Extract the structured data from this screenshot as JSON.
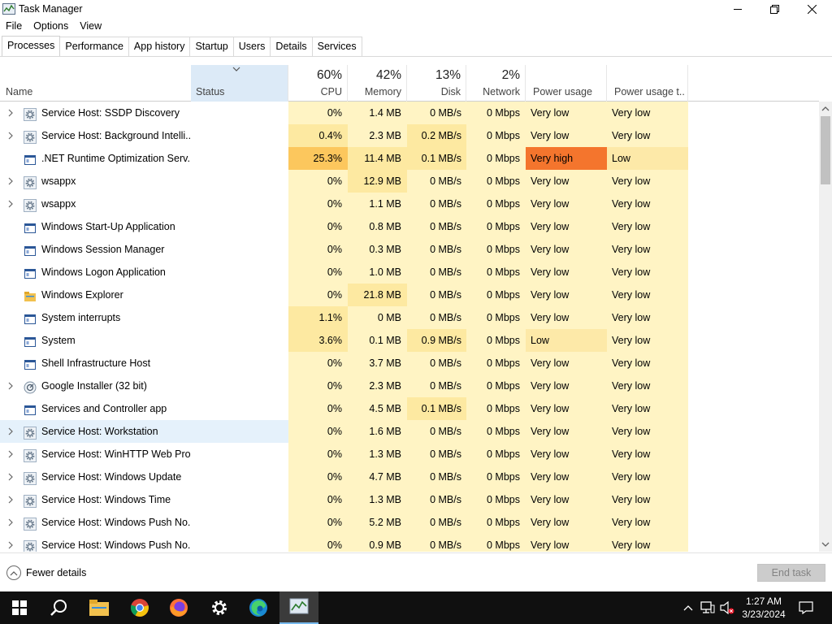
{
  "window": {
    "title": "Task Manager"
  },
  "menu": [
    "File",
    "Options",
    "View"
  ],
  "tabs": [
    "Processes",
    "Performance",
    "App history",
    "Startup",
    "Users",
    "Details",
    "Services"
  ],
  "active_tab": "Processes",
  "columns": {
    "name": "Name",
    "status": "Status",
    "cpu": {
      "pct": "60%",
      "label": "CPU"
    },
    "memory": {
      "pct": "42%",
      "label": "Memory"
    },
    "disk": {
      "pct": "13%",
      "label": "Disk"
    },
    "network": {
      "pct": "2%",
      "label": "Network"
    },
    "power": "Power usage",
    "power_trend": "Power usage t..."
  },
  "processes": [
    {
      "name": "Service Host: SSDP Discovery",
      "icon": "gear-icon",
      "expandable": true,
      "cpu": "0%",
      "mem": "1.4 MB",
      "disk": "0 MB/s",
      "net": "0 Mbps",
      "power": "Very low",
      "power_trend": "Very low"
    },
    {
      "name": "Service Host: Background Intelli...",
      "icon": "gear-icon",
      "expandable": true,
      "cpu": "0.4%",
      "mem": "2.3 MB",
      "disk": "0.2 MB/s",
      "net": "0 Mbps",
      "power": "Very low",
      "power_trend": "Very low"
    },
    {
      "name": ".NET Runtime Optimization Serv...",
      "icon": "window-icon",
      "expandable": false,
      "cpu": "25.3%",
      "mem": "11.4 MB",
      "disk": "0.1 MB/s",
      "net": "0 Mbps",
      "power": "Very high",
      "power_trend": "Low"
    },
    {
      "name": "wsappx",
      "icon": "gear-icon",
      "expandable": true,
      "cpu": "0%",
      "mem": "12.9 MB",
      "disk": "0 MB/s",
      "net": "0 Mbps",
      "power": "Very low",
      "power_trend": "Very low"
    },
    {
      "name": "wsappx",
      "icon": "gear-icon",
      "expandable": true,
      "cpu": "0%",
      "mem": "1.1 MB",
      "disk": "0 MB/s",
      "net": "0 Mbps",
      "power": "Very low",
      "power_trend": "Very low"
    },
    {
      "name": "Windows Start-Up Application",
      "icon": "window-icon",
      "expandable": false,
      "cpu": "0%",
      "mem": "0.8 MB",
      "disk": "0 MB/s",
      "net": "0 Mbps",
      "power": "Very low",
      "power_trend": "Very low"
    },
    {
      "name": "Windows Session Manager",
      "icon": "window-icon",
      "expandable": false,
      "cpu": "0%",
      "mem": "0.3 MB",
      "disk": "0 MB/s",
      "net": "0 Mbps",
      "power": "Very low",
      "power_trend": "Very low"
    },
    {
      "name": "Windows Logon Application",
      "icon": "window-icon",
      "expandable": false,
      "cpu": "0%",
      "mem": "1.0 MB",
      "disk": "0 MB/s",
      "net": "0 Mbps",
      "power": "Very low",
      "power_trend": "Very low"
    },
    {
      "name": "Windows Explorer",
      "icon": "folder-icon",
      "expandable": false,
      "cpu": "0%",
      "mem": "21.8 MB",
      "disk": "0 MB/s",
      "net": "0 Mbps",
      "power": "Very low",
      "power_trend": "Very low"
    },
    {
      "name": "System interrupts",
      "icon": "window-icon",
      "expandable": false,
      "cpu": "1.1%",
      "mem": "0 MB",
      "disk": "0 MB/s",
      "net": "0 Mbps",
      "power": "Very low",
      "power_trend": "Very low"
    },
    {
      "name": "System",
      "icon": "window-icon",
      "expandable": false,
      "cpu": "3.6%",
      "mem": "0.1 MB",
      "disk": "0.9 MB/s",
      "net": "0 Mbps",
      "power": "Low",
      "power_trend": "Very low"
    },
    {
      "name": "Shell Infrastructure Host",
      "icon": "window-icon",
      "expandable": false,
      "cpu": "0%",
      "mem": "3.7 MB",
      "disk": "0 MB/s",
      "net": "0 Mbps",
      "power": "Very low",
      "power_trend": "Very low"
    },
    {
      "name": "Google Installer (32 bit)",
      "icon": "installer-icon",
      "expandable": true,
      "cpu": "0%",
      "mem": "2.3 MB",
      "disk": "0 MB/s",
      "net": "0 Mbps",
      "power": "Very low",
      "power_trend": "Very low"
    },
    {
      "name": "Services and Controller app",
      "icon": "window-icon",
      "expandable": false,
      "cpu": "0%",
      "mem": "4.5 MB",
      "disk": "0.1 MB/s",
      "net": "0 Mbps",
      "power": "Very low",
      "power_trend": "Very low"
    },
    {
      "name": "Service Host: Workstation",
      "icon": "gear-icon",
      "expandable": true,
      "cpu": "0%",
      "mem": "1.6 MB",
      "disk": "0 MB/s",
      "net": "0 Mbps",
      "power": "Very low",
      "power_trend": "Very low",
      "hover": true
    },
    {
      "name": "Service Host: WinHTTP Web Pro...",
      "icon": "gear-icon",
      "expandable": true,
      "cpu": "0%",
      "mem": "1.3 MB",
      "disk": "0 MB/s",
      "net": "0 Mbps",
      "power": "Very low",
      "power_trend": "Very low"
    },
    {
      "name": "Service Host: Windows Update",
      "icon": "gear-icon",
      "expandable": true,
      "cpu": "0%",
      "mem": "4.7 MB",
      "disk": "0 MB/s",
      "net": "0 Mbps",
      "power": "Very low",
      "power_trend": "Very low"
    },
    {
      "name": "Service Host: Windows Time",
      "icon": "gear-icon",
      "expandable": true,
      "cpu": "0%",
      "mem": "1.3 MB",
      "disk": "0 MB/s",
      "net": "0 Mbps",
      "power": "Very low",
      "power_trend": "Very low"
    },
    {
      "name": "Service Host: Windows Push No...",
      "icon": "gear-icon",
      "expandable": true,
      "cpu": "0%",
      "mem": "5.2 MB",
      "disk": "0 MB/s",
      "net": "0 Mbps",
      "power": "Very low",
      "power_trend": "Very low"
    },
    {
      "name": "Service Host: Windows Push No...",
      "icon": "gear-icon",
      "expandable": true,
      "cpu": "0%",
      "mem": "0.9 MB",
      "disk": "0 MB/s",
      "net": "0 Mbps",
      "power": "Very low",
      "power_trend": "Very low"
    }
  ],
  "footer": {
    "fewer_details": "Fewer details",
    "end_task": "End task"
  },
  "taskbar": {
    "apps": [
      "windows-start-icon",
      "search-icon",
      "file-explorer-icon",
      "chrome-icon",
      "firefox-icon",
      "settings-icon",
      "edge-icon",
      "task-manager-icon"
    ],
    "active_app": "task-manager-icon",
    "time": "1:27 AM",
    "date": "3/23/2024"
  },
  "colors": {
    "very_low": "#fff4c4",
    "low": "#fde9a8",
    "elevated": "#fde9a1",
    "high": "#fcc75d",
    "very_high": "#f4752d",
    "selected_tab_border": "#d0d0d0",
    "taskbar": "#101010",
    "accent": "#76b9ed"
  }
}
